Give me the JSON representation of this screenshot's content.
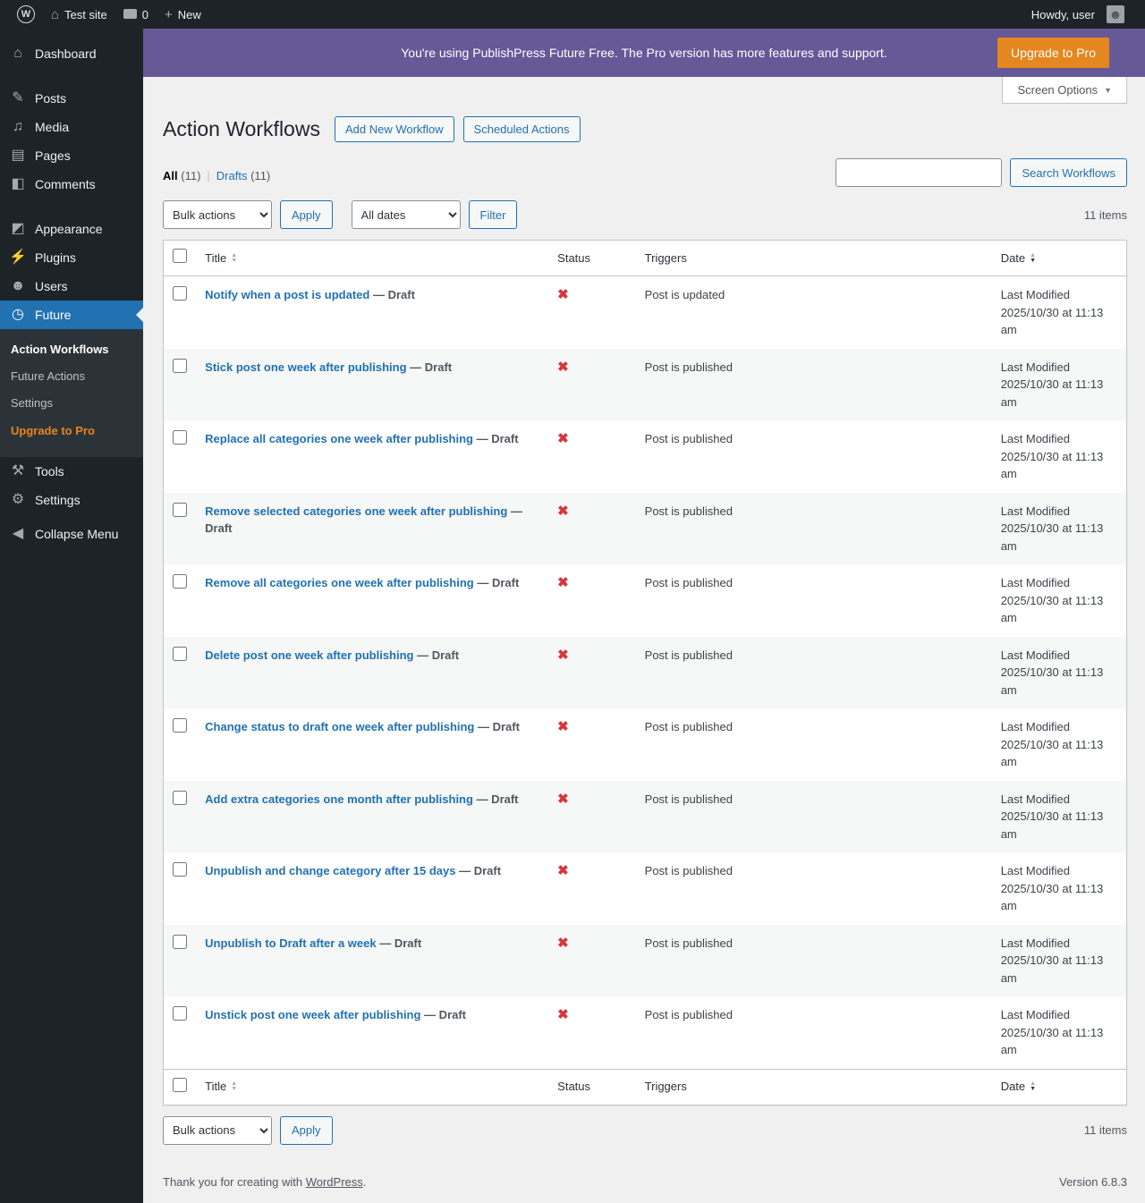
{
  "colors": {
    "accent_blue": "#2271b1",
    "sidebar_dark": "#1d2327",
    "banner_purple": "#655997",
    "button_orange": "#e5861f",
    "status_red": "#d63638"
  },
  "icons": {
    "wp_logo": "W",
    "home": "⌂",
    "plus": "+",
    "person": "☻",
    "dashboard": "⌂",
    "posts": "✎",
    "media": "♫",
    "pages": "▤",
    "comments": "◧",
    "appearance": "◩",
    "plugins": "⚡",
    "users": "☻",
    "future": "◷",
    "tools": "⚒",
    "settings": "⚙",
    "collapse": "◀",
    "inactive": "✖",
    "sort_up": "▲",
    "sort_down": "▼",
    "caret_down": "▼"
  },
  "admin_bar": {
    "site_name": "Test site",
    "comments_count": "0",
    "new_label": "New",
    "howdy": "Howdy, user"
  },
  "sidebar": {
    "items": {
      "dashboard": "Dashboard",
      "posts": "Posts",
      "media": "Media",
      "pages": "Pages",
      "comments": "Comments",
      "appearance": "Appearance",
      "plugins": "Plugins",
      "users": "Users",
      "future": "Future",
      "tools": "Tools",
      "settings": "Settings",
      "collapse": "Collapse Menu"
    },
    "future_submenu": {
      "action_workflows": "Action Workflows",
      "future_actions": "Future Actions",
      "settings": "Settings",
      "upgrade": "Upgrade to Pro"
    }
  },
  "banner": {
    "message": "You're using PublishPress Future Free. The Pro version has more features and support.",
    "button": "Upgrade to Pro"
  },
  "screen_options_label": "Screen Options",
  "page": {
    "title": "Action Workflows",
    "add_new_button": "Add New Workflow",
    "scheduled_actions_button": "Scheduled Actions",
    "views": {
      "all": "All",
      "all_count": "(11)",
      "separator": "|",
      "drafts": "Drafts",
      "drafts_count": "(11)"
    },
    "search_button": "Search Workflows"
  },
  "tablenav": {
    "bulk_actions": "Bulk actions",
    "apply": "Apply",
    "all_dates": "All dates",
    "filter": "Filter",
    "items_count": "11 items"
  },
  "table": {
    "headers": {
      "title": "Title",
      "status": "Status",
      "triggers": "Triggers",
      "date": "Date"
    },
    "rows": [
      {
        "title": "Notify when a post is updated",
        "state": "— Draft",
        "trigger": "Post is updated",
        "date": "Last Modified 2025/10/30 at 11:13 am"
      },
      {
        "title": "Stick post one week after publishing",
        "state": "— Draft",
        "trigger": "Post is published",
        "date": "Last Modified 2025/10/30 at 11:13 am"
      },
      {
        "title": "Replace all categories one week after publishing",
        "state": "— Draft",
        "trigger": "Post is published",
        "date": "Last Modified 2025/10/30 at 11:13 am"
      },
      {
        "title": "Remove selected categories one week after publishing",
        "state": "— Draft",
        "trigger": "Post is published",
        "date": "Last Modified 2025/10/30 at 11:13 am"
      },
      {
        "title": "Remove all categories one week after publishing",
        "state": "— Draft",
        "trigger": "Post is published",
        "date": "Last Modified 2025/10/30 at 11:13 am"
      },
      {
        "title": "Delete post one week after publishing",
        "state": "— Draft",
        "trigger": "Post is published",
        "date": "Last Modified 2025/10/30 at 11:13 am"
      },
      {
        "title": "Change status to draft one week after publishing",
        "state": "— Draft",
        "trigger": "Post is published",
        "date": "Last Modified 2025/10/30 at 11:13 am"
      },
      {
        "title": "Add extra categories one month after publishing",
        "state": "— Draft",
        "trigger": "Post is published",
        "date": "Last Modified 2025/10/30 at 11:13 am"
      },
      {
        "title": "Unpublish and change category after 15 days",
        "state": "— Draft",
        "trigger": "Post is published",
        "date": "Last Modified 2025/10/30 at 11:13 am"
      },
      {
        "title": "Unpublish to Draft after a week",
        "state": "— Draft",
        "trigger": "Post is published",
        "date": "Last Modified 2025/10/30 at 11:13 am"
      },
      {
        "title": "Unstick post one week after publishing",
        "state": "— Draft",
        "trigger": "Post is published",
        "date": "Last Modified 2025/10/30 at 11:13 am"
      }
    ]
  },
  "footer": {
    "thanks": "Thank you for creating with",
    "wordpress_link": "WordPress",
    "period": ".",
    "version": "Version 6.8.3"
  }
}
